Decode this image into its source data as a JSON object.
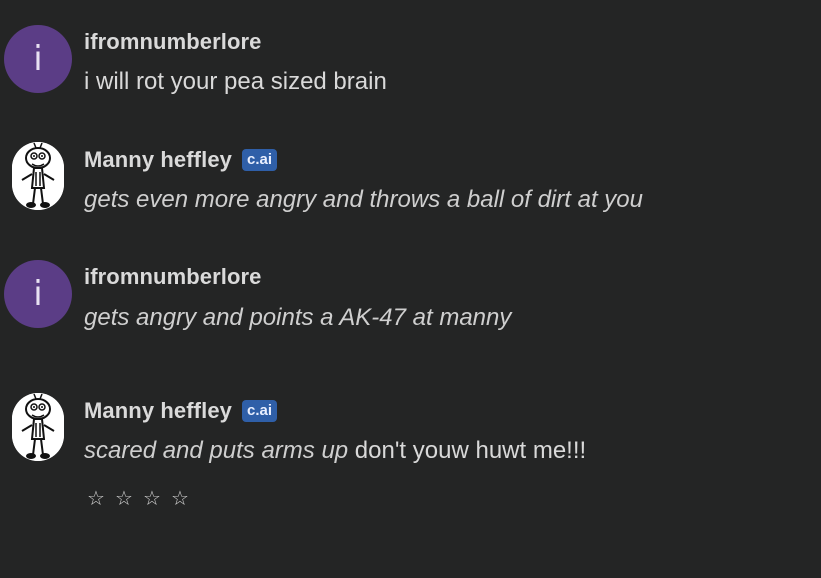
{
  "messages": [
    {
      "author": "ifromnumberlore",
      "avatar_letter": "i",
      "text_italic": "",
      "text_plain": "i will rot your pea sized brain"
    },
    {
      "author": "Manny heffley",
      "badge": "c.ai",
      "text_italic": "gets even more angry and throws a ball of dirt at you",
      "text_plain": ""
    },
    {
      "author": "ifromnumberlore",
      "avatar_letter": "i",
      "text_italic": "gets angry and points a AK-47 at manny",
      "text_plain": ""
    },
    {
      "author": "Manny heffley",
      "badge": "c.ai",
      "text_italic": "scared and puts arms up",
      "text_plain": " don't youw huwt me!!!"
    }
  ],
  "rating": {
    "stars": [
      "☆",
      "☆",
      "☆",
      "☆"
    ],
    "value": 0
  },
  "colors": {
    "background": "#242525",
    "user_avatar": "#5b3d86",
    "badge": "#2f5fa8"
  }
}
